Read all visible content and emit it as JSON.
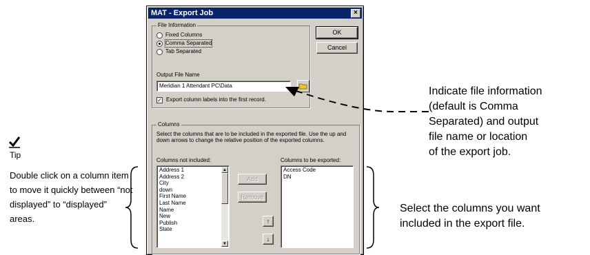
{
  "dialog": {
    "title": "MAT - Export Job",
    "close_glyph": "×",
    "file_info": {
      "legend": "File Information",
      "options": [
        "Fixed Columns",
        "Comma Separated",
        "Tab Separated"
      ],
      "selected": "Comma Separated"
    },
    "ok_label": "OK",
    "cancel_label": "Cancel",
    "output_label": "Output File Name",
    "output_value": "Meridian 1 Attendant PC\\Data",
    "export_labels_checkbox": "Export column labels into the first record.",
    "export_labels_checked": true,
    "columns": {
      "legend": "Columns",
      "instructions": "Select the columns that are to be included in the exported file. Use the up and down arrows to change the relative position of the exported columns.",
      "not_included_label": "Columns not included:",
      "not_included": [
        "Address 1",
        "Address 2",
        "City",
        "down",
        "First Name",
        "Last Name",
        "Name",
        "New",
        "Publish",
        "State"
      ],
      "to_export_label": "Columns to be exported:",
      "to_export": [
        "Access Code",
        "DN"
      ],
      "add_label": "Add",
      "remove_label": "Remove",
      "up_glyph": "↑",
      "down_glyph": "↓"
    }
  },
  "annotations": {
    "tip_label": "Tip",
    "tip_text": "Double click on a column item to move it quickly between “not displayed” to “displayed” areas.",
    "file_info_note": [
      "Indicate file information",
      "(default is Comma",
      "Separated) and output",
      "file name or location",
      "of the export job."
    ],
    "columns_note": [
      "Select the columns you want",
      "included in the export file."
    ]
  }
}
